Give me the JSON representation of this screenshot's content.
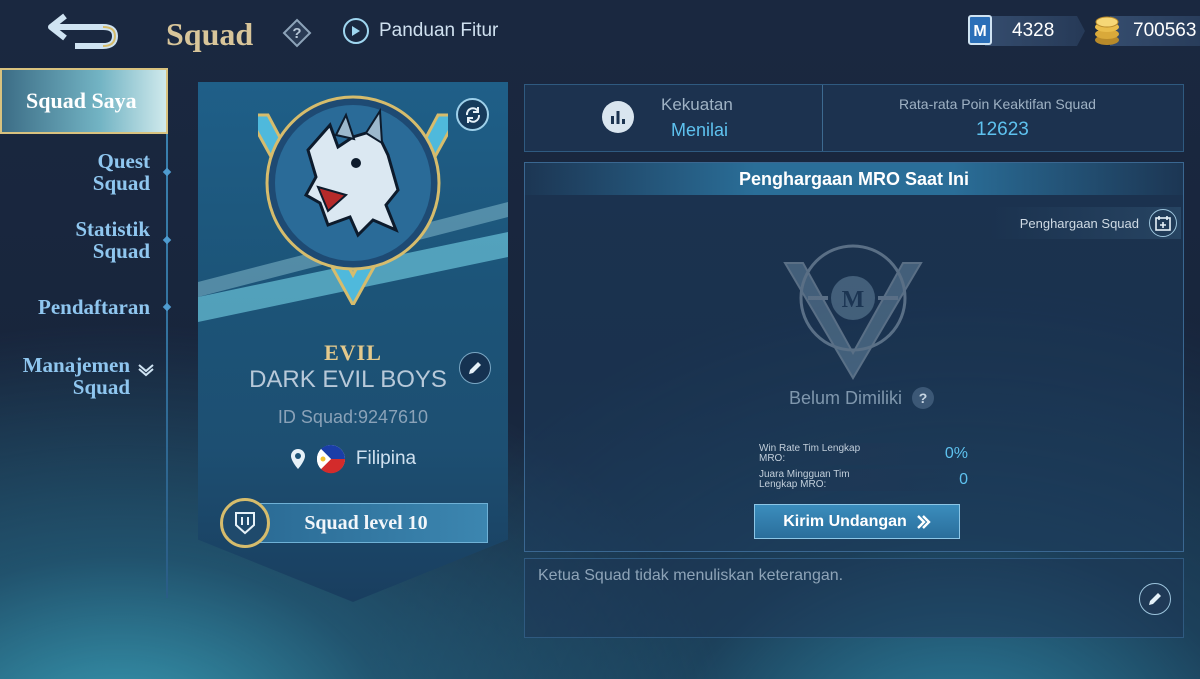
{
  "header": {
    "title": "Squad",
    "guide_label": "Panduan Fitur",
    "currency_ticket": "4328",
    "currency_gold": "700563"
  },
  "sidebar": {
    "items": [
      {
        "label": "Squad Saya"
      },
      {
        "label": "Quest\nSquad"
      },
      {
        "label": "Statistik\nSquad"
      },
      {
        "label": "Pendaftaran"
      },
      {
        "label": "Manajemen\nSquad"
      }
    ]
  },
  "squad": {
    "tag": "EVIL",
    "name": "DARK EVIL BOYS",
    "id": "ID Squad:9247610",
    "country": "Filipina",
    "level": "Squad level 10"
  },
  "stats": {
    "power_label": "Kekuatan",
    "power_value": "Menilai",
    "activity_label": "Rata-rata Poin Keaktifan Squad",
    "activity_value": "12623"
  },
  "mro": {
    "heading": "Penghargaan MRO Saat Ini",
    "award_button": "Penghargaan Squad",
    "status": "Belum Dimiliki",
    "rows": [
      {
        "label": "Win Rate Tim Lengkap MRO:",
        "value": "0%"
      },
      {
        "label": "Juara Mingguan Tim Lengkap MRO:",
        "value": "0"
      }
    ],
    "invite_button": "Kirim Undangan"
  },
  "description": "Ketua Squad tidak menuliskan keterangan.",
  "colors": {
    "accent": "#5ec2ef",
    "gold": "#d8c59a"
  }
}
